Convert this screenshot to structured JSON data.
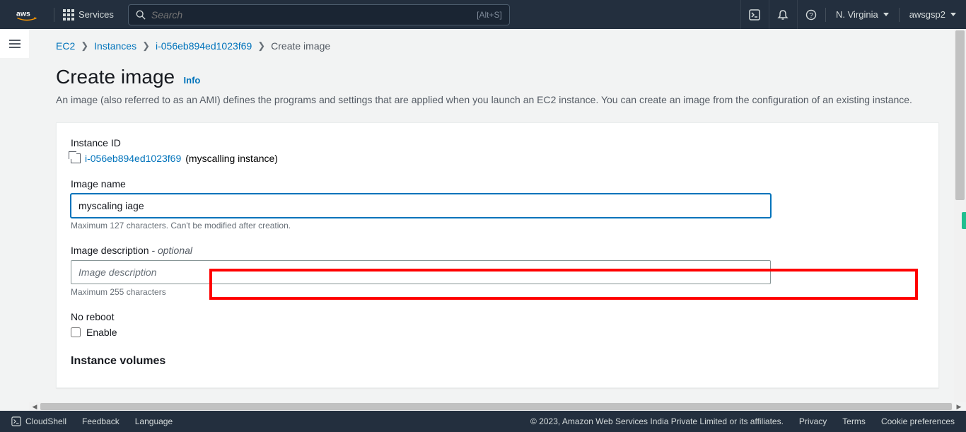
{
  "topnav": {
    "services_label": "Services",
    "search_placeholder": "Search",
    "search_kbd": "[Alt+S]",
    "region": "N. Virginia",
    "account": "awsgsp2"
  },
  "breadcrumb": {
    "ec2": "EC2",
    "instances": "Instances",
    "instance_id": "i-056eb894ed1023f69",
    "current": "Create image"
  },
  "page": {
    "title": "Create image",
    "info": "Info",
    "description": "An image (also referred to as an AMI) defines the programs and settings that are applied when you launch an EC2 instance. You can create an image from the configuration of an existing instance."
  },
  "form": {
    "instance_id_label": "Instance ID",
    "instance_id_link": "i-056eb894ed1023f69",
    "instance_name": "(myscalling instance)",
    "image_name_label": "Image name",
    "image_name_value": "myscaling iage",
    "image_name_hint": "Maximum 127 characters. Can't be modified after creation.",
    "image_desc_label": "Image description",
    "image_desc_optional": " - optional",
    "image_desc_placeholder": "Image description",
    "image_desc_hint": "Maximum 255 characters",
    "no_reboot_label": "No reboot",
    "enable_label": "Enable",
    "volumes_title": "Instance volumes"
  },
  "bottombar": {
    "cloudshell": "CloudShell",
    "feedback": "Feedback",
    "language": "Language",
    "copyright": "© 2023, Amazon Web Services India Private Limited or its affiliates.",
    "privacy": "Privacy",
    "terms": "Terms",
    "cookie": "Cookie preferences"
  }
}
